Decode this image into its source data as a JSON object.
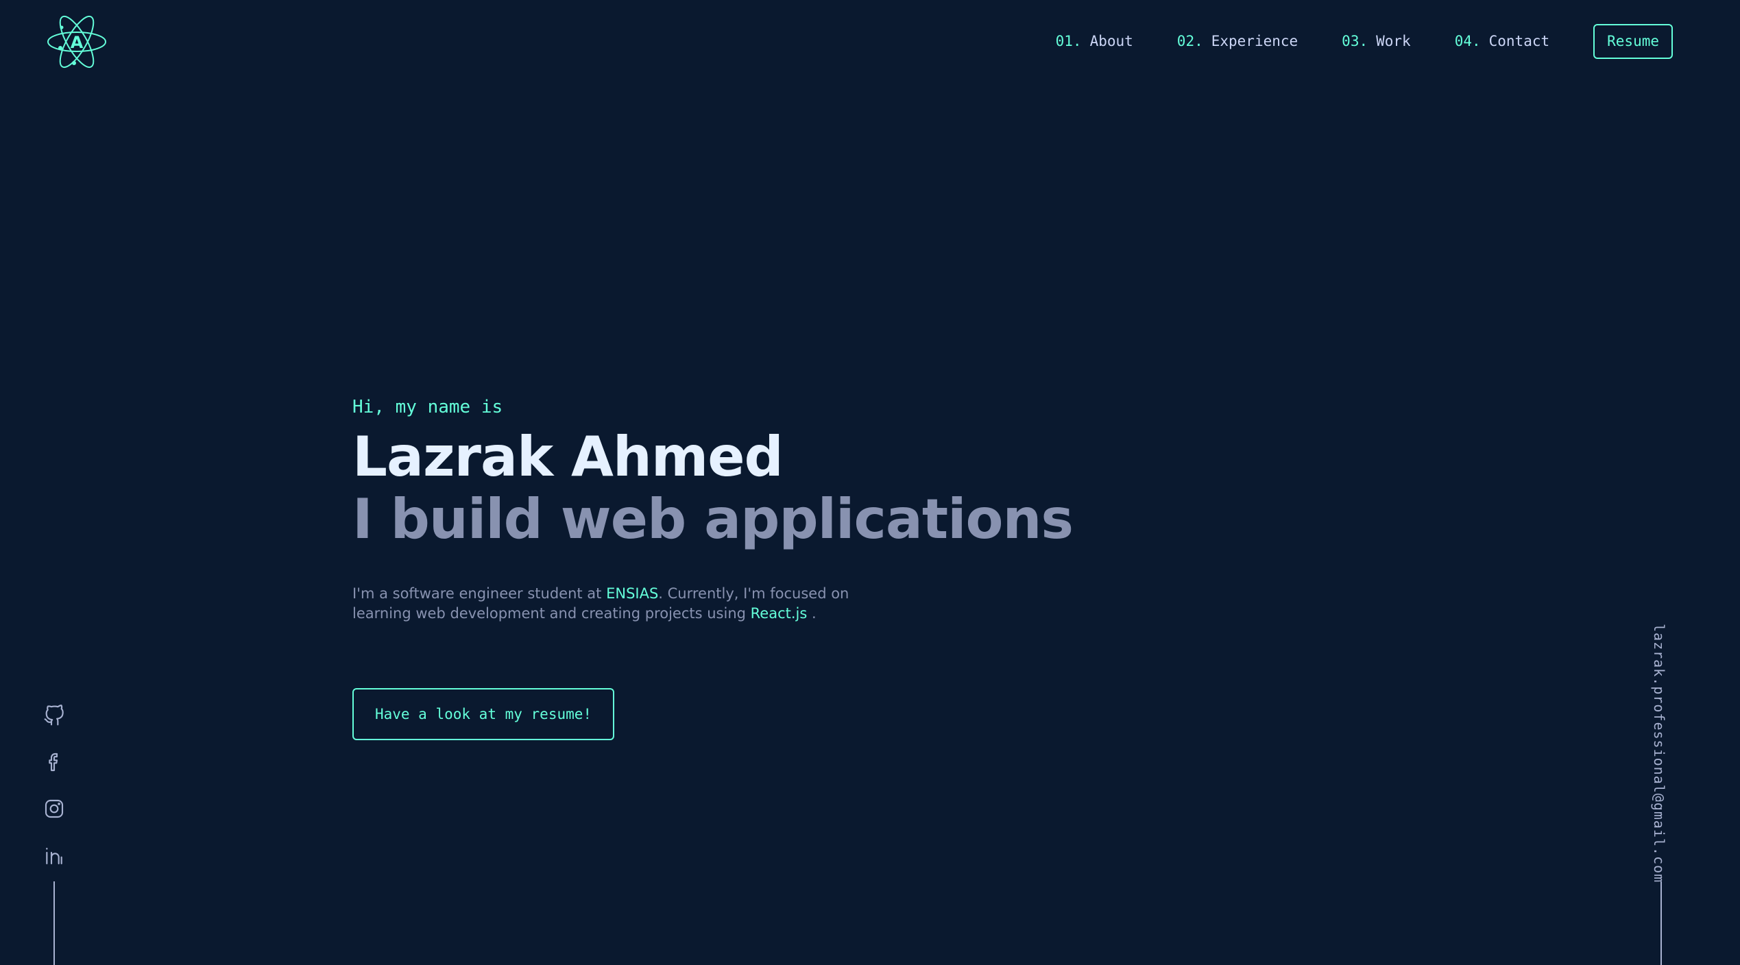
{
  "header": {
    "logo_icon": "atom-logo-icon",
    "logo_letter": "A",
    "nav": [
      {
        "num": "01.",
        "label": "About"
      },
      {
        "num": "02.",
        "label": "Experience"
      },
      {
        "num": "03.",
        "label": "Work"
      },
      {
        "num": "04.",
        "label": "Contact"
      }
    ],
    "resume_label": "Resume"
  },
  "hero": {
    "greeting": "Hi, my name is",
    "name": "Lazrak Ahmed",
    "tagline": "I build web applications",
    "desc_part1": "I'm a software engineer student at ",
    "desc_school": "ENSIAS",
    "desc_part2": ". Currently, I'm focused on learning web development and creating projects using ",
    "desc_tech": "React.js",
    "desc_part3": " .",
    "cta_label": "Have a look at my resume!"
  },
  "social": [
    {
      "icon": "github-icon"
    },
    {
      "icon": "facebook-icon"
    },
    {
      "icon": "instagram-icon"
    },
    {
      "icon": "linkedin-icon"
    }
  ],
  "email": "lazrak.professional@gmail.com",
  "colors": {
    "background": "#0a192f",
    "accent": "#64ffda",
    "heading": "#e6f1ff",
    "text": "#8892b0",
    "light": "#ccd6f6"
  }
}
